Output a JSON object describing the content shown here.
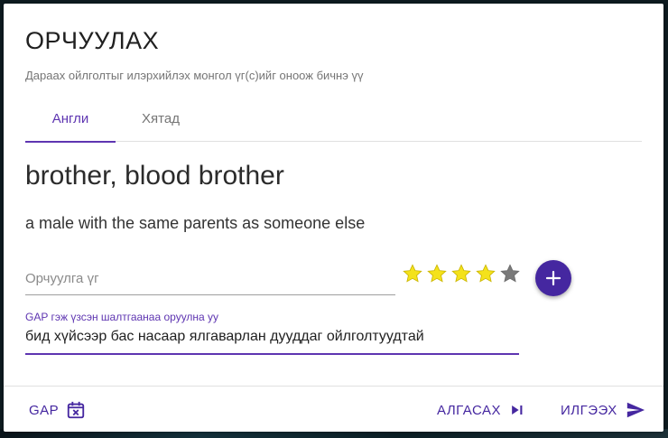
{
  "dialog": {
    "title": "ОРЧУУЛАХ",
    "subtitle": "Дараах ойлголтыг илэрхийлэх монгол үг(с)ийг оноож бичнэ үү"
  },
  "tabs": [
    {
      "label": "Англи",
      "active": true
    },
    {
      "label": "Хятад",
      "active": false
    }
  ],
  "term": {
    "word": "brother, blood brother",
    "definition": "a male with the same parents as someone else"
  },
  "translation_input": {
    "placeholder": "Орчуулга үг",
    "value": ""
  },
  "rating": {
    "value": 4,
    "max": 5,
    "filled_color": "#f4e21b",
    "empty_color": "#7a7a7a",
    "icon": "star-icon"
  },
  "add_button": {
    "icon": "plus-icon"
  },
  "gap_field": {
    "label": "GAP гэж үзсэн шалтгаанаа оруулна уу",
    "value": "бид хүйсээр бас насаар ялгаварлан дууддаг ойлголтуудтай"
  },
  "footer": {
    "gap_label": "GAP",
    "gap_icon": "calendar-remove-icon",
    "skip_label": "АЛГАСАХ",
    "skip_icon": "skip-next-icon",
    "send_label": "ИЛГЭЭХ",
    "send_icon": "send-icon"
  },
  "colors": {
    "accent": "#5e35b1",
    "fab": "#4527a0"
  }
}
